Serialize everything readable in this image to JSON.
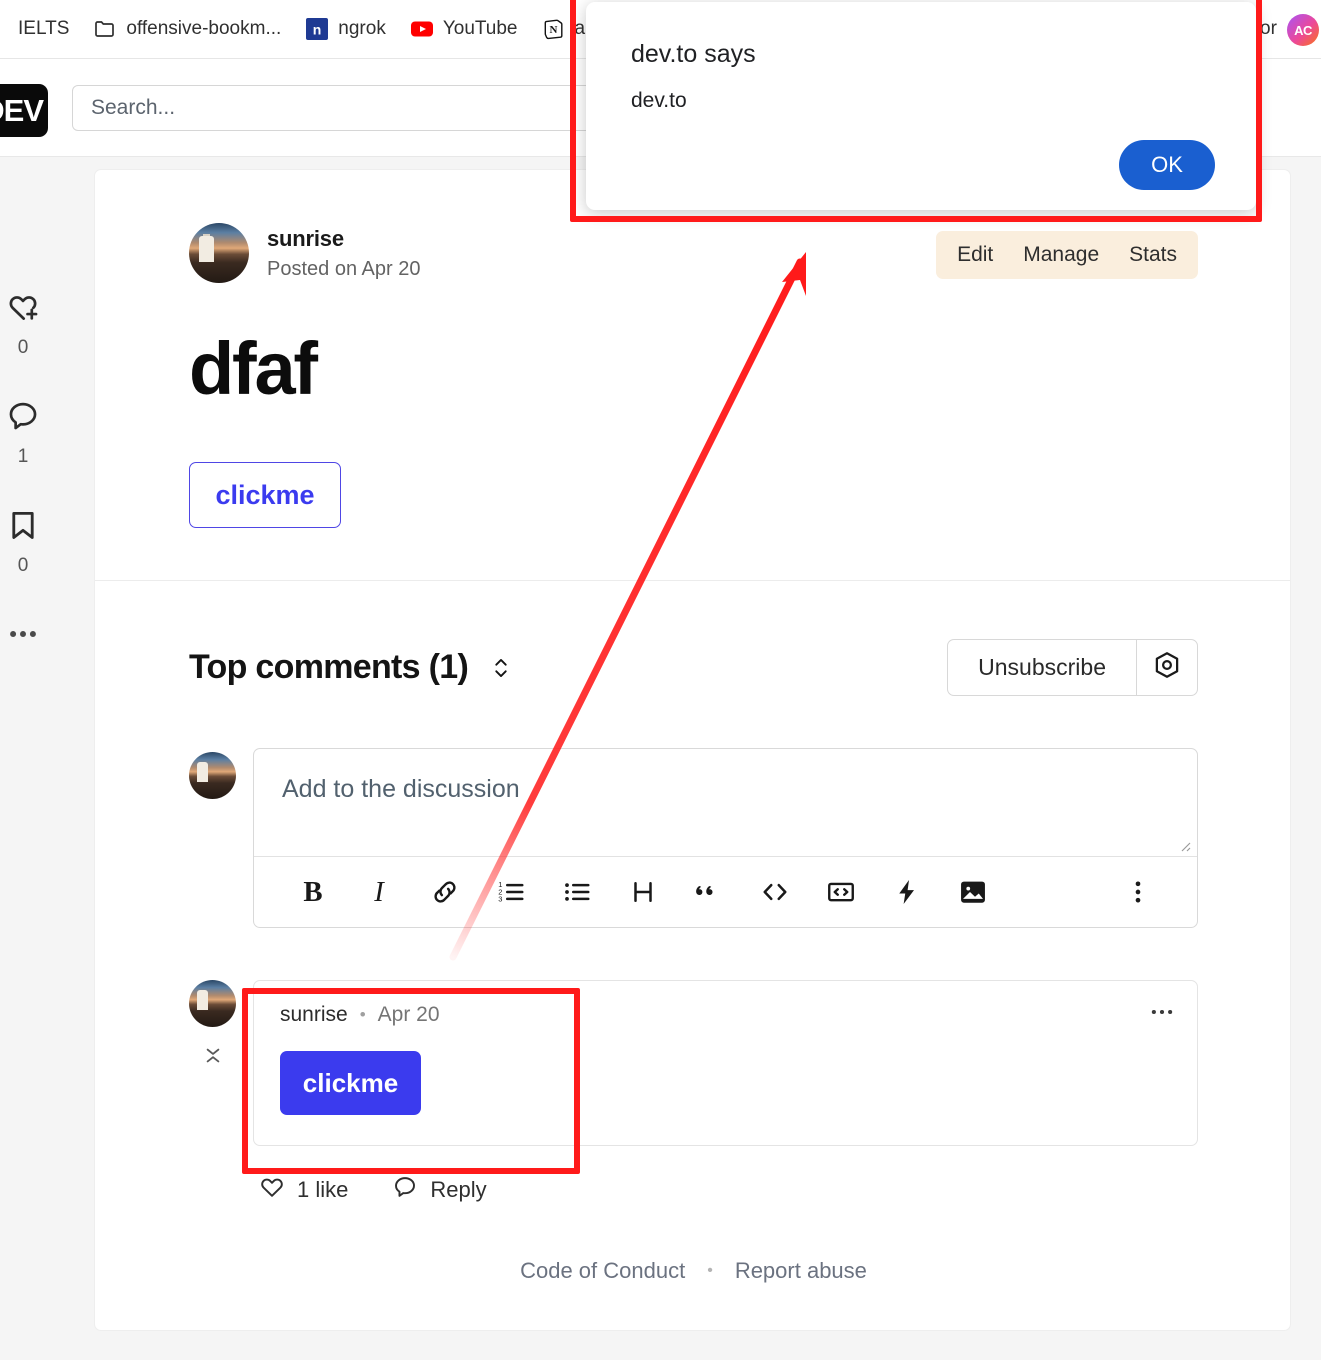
{
  "browser": {
    "bookmarks": [
      {
        "label": "IELTS",
        "icon": "none"
      },
      {
        "label": "offensive-bookm...",
        "icon": "folder-icon"
      },
      {
        "label": "ngrok",
        "icon": "ngrok-icon"
      },
      {
        "label": "YouTube",
        "icon": "youtube-icon"
      },
      {
        "label": "ap",
        "icon": "notion-icon"
      },
      {
        "label": "or",
        "icon": "none"
      }
    ],
    "profile_initials": "AC"
  },
  "dev_header": {
    "logo": "DEV",
    "search_placeholder": "Search..."
  },
  "rail": {
    "reactions_count": "0",
    "comments_count": "1",
    "bookmarks_count": "0",
    "more_label": "•••"
  },
  "article": {
    "author": "sunrise",
    "posted_on": "Posted on Apr 20",
    "title": "dfaf",
    "body_button_label": "clickme",
    "actions": [
      {
        "label": "Edit"
      },
      {
        "label": "Manage"
      },
      {
        "label": "Stats"
      }
    ]
  },
  "comments": {
    "heading": "Top comments (1)",
    "subscribe_label": "Unsubscribe",
    "editor_placeholder": "Add to the discussion",
    "toolbar": [
      {
        "name": "bold",
        "glyph": "B"
      },
      {
        "name": "italic",
        "glyph": "I"
      },
      {
        "name": "link",
        "glyph": "link"
      },
      {
        "name": "ordered-list",
        "glyph": "ol"
      },
      {
        "name": "unordered-list",
        "glyph": "ul"
      },
      {
        "name": "heading",
        "glyph": "H"
      },
      {
        "name": "quote",
        "glyph": "quote"
      },
      {
        "name": "code",
        "glyph": "code"
      },
      {
        "name": "code-block",
        "glyph": "codeblock"
      },
      {
        "name": "embed",
        "glyph": "bolt"
      },
      {
        "name": "image",
        "glyph": "image"
      }
    ],
    "items": [
      {
        "author": "sunrise",
        "separator": "•",
        "date": "Apr 20",
        "button_label": "clickme",
        "likes_label": "1 like",
        "reply_label": "Reply"
      }
    ]
  },
  "footer": {
    "code_of_conduct": "Code of Conduct",
    "separator": "•",
    "report_abuse": "Report abuse"
  },
  "dialog": {
    "title": "dev.to says",
    "message": "dev.to",
    "ok_label": "OK"
  },
  "colors": {
    "annotation_red": "#ff1a1a",
    "dialog_ok_blue": "#1a5fd0",
    "clickme_blue": "#3b3bee",
    "actions_pill_bg": "#faeedd"
  }
}
